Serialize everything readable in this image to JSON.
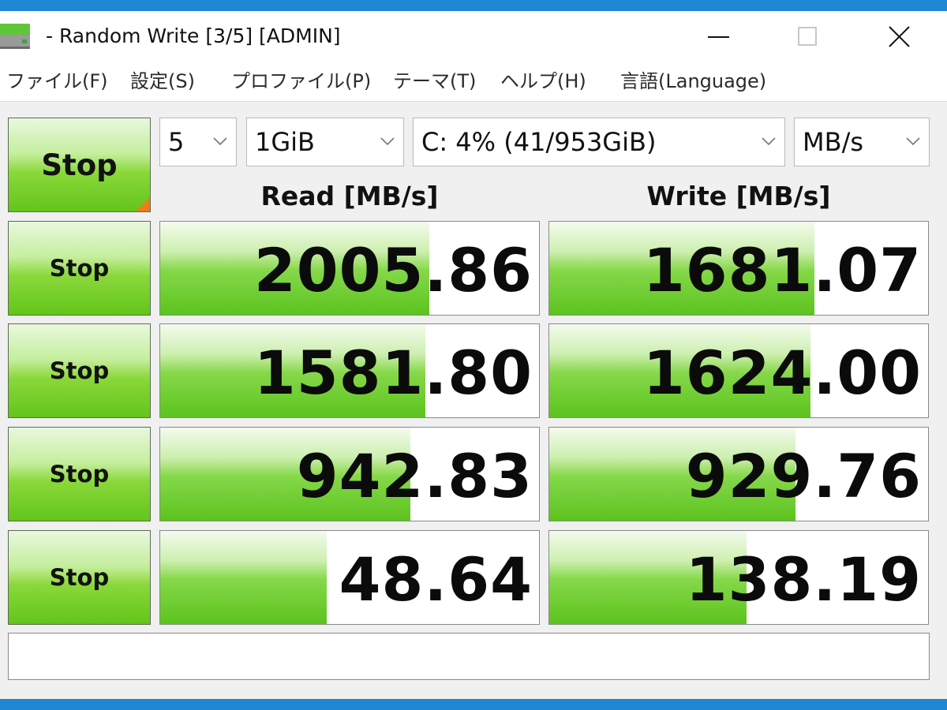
{
  "window": {
    "title": "- Random Write [3/5] [ADMIN]",
    "icon": "disk-icon",
    "controls": {
      "minimize": "minimize-icon",
      "maximize": "maximize-icon",
      "close": "close-icon"
    }
  },
  "menu": {
    "file": "ファイル(F)",
    "settings": "設定(S)",
    "profile": "プロファイル(P)",
    "theme": "テーマ(T)",
    "help": "ヘルプ(H)",
    "language": "言語(Language)"
  },
  "controls": {
    "main_button": "Stop",
    "count": "5",
    "size": "1GiB",
    "drive": "C: 4% (41/953GiB)",
    "unit": "MB/s"
  },
  "headers": {
    "read": "Read [MB/s]",
    "write": "Write [MB/s]"
  },
  "rows": [
    {
      "button": "Stop",
      "read": "2005.86",
      "write": "1681.07",
      "read_fill": 0.71,
      "write_fill": 0.7
    },
    {
      "button": "Stop",
      "read": "1581.80",
      "write": "1624.00",
      "read_fill": 0.7,
      "write_fill": 0.69
    },
    {
      "button": "Stop",
      "read": "942.83",
      "write": "929.76",
      "read_fill": 0.66,
      "write_fill": 0.65
    },
    {
      "button": "Stop",
      "read": "48.64",
      "write": "138.19",
      "read_fill": 0.44,
      "write_fill": 0.52
    }
  ],
  "comment": "",
  "colors": {
    "bar_green": "#5cc31e",
    "corner_orange": "#ef7d1b",
    "desktop_blue": "#1e88d4"
  }
}
